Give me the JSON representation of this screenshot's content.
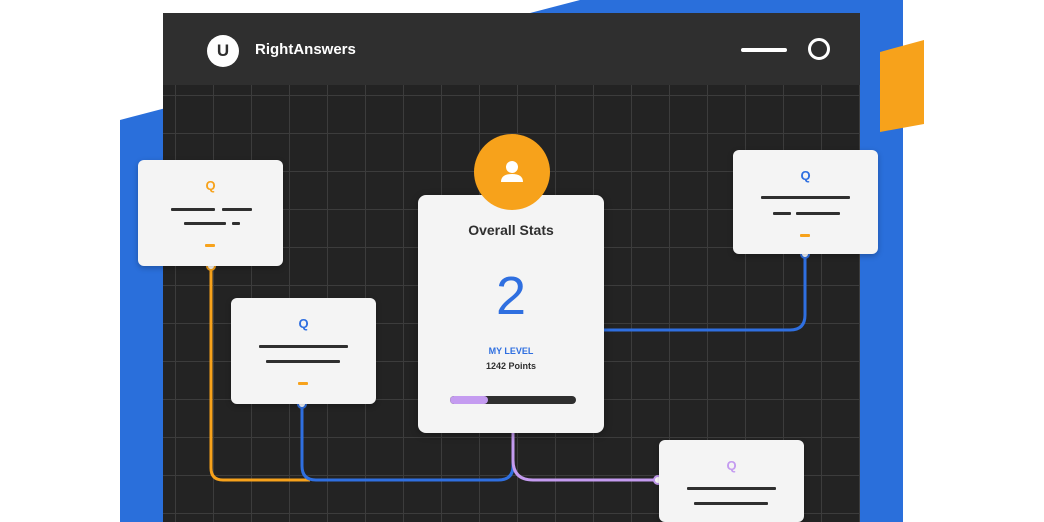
{
  "app": {
    "logo_letter": "U",
    "title": "RightAnswers"
  },
  "colors": {
    "blue_backdrop": "#2a6fdb",
    "window_bg": "#232323",
    "titlebar_bg": "#2f2f2f",
    "orange": "#f7a21b",
    "blue": "#2f6fe0",
    "purple": "#c49bf0",
    "card_bg": "#f4f4f4"
  },
  "stats": {
    "title": "Overall Stats",
    "level_value": "2",
    "level_label": "MY LEVEL",
    "points": "1242 Points",
    "progress": 0.3
  },
  "cards": [
    {
      "icon_letter": "Q",
      "accent": "#f7a21b"
    },
    {
      "icon_letter": "Q",
      "accent": "#2f6fe0"
    },
    {
      "icon_letter": "Q",
      "accent": "#2f6fe0"
    },
    {
      "icon_letter": "Q",
      "accent": "#c49bf0"
    }
  ],
  "icons": {
    "avatar": "user-icon",
    "window_minimize": "minimize-icon",
    "window_circle": "circle-icon"
  }
}
